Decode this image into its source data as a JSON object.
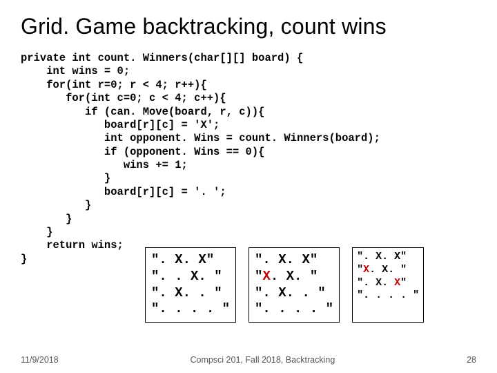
{
  "title": "Grid. Game backtracking, count wins",
  "code_lines": [
    "private int count. Winners(char[][] board) {",
    "    int wins = 0;",
    "    for(int r=0; r < 4; r++){",
    "       for(int c=0; c < 4; c++){",
    "          if (can. Move(board, r, c)){",
    "             board[r][c] = 'X';",
    "             int opponent. Wins = count. Winners(board);",
    "             if (opponent. Wins == 0){",
    "                wins += 1;",
    "             }",
    "             board[r][c] = '. ';",
    "          }",
    "       }",
    "    }",
    "    return wins;",
    "}"
  ],
  "boards": [
    {
      "size": "big",
      "rows": [
        [
          {
            "t": "\". X. X\""
          }
        ],
        [
          {
            "t": "\". . X. \""
          }
        ],
        [
          {
            "t": "\". X. . \""
          }
        ],
        [
          {
            "t": "\". . . . \""
          }
        ]
      ]
    },
    {
      "size": "big",
      "rows": [
        [
          {
            "t": "\". X. X\""
          }
        ],
        [
          {
            "t": "\""
          },
          {
            "t": "X",
            "red": true
          },
          {
            "t": ". X. \""
          }
        ],
        [
          {
            "t": "\". X. . \""
          }
        ],
        [
          {
            "t": "\". . . . \""
          }
        ]
      ]
    },
    {
      "size": "small",
      "rows": [
        [
          {
            "t": "\". X. X\""
          }
        ],
        [
          {
            "t": "\""
          },
          {
            "t": "X",
            "red": true
          },
          {
            "t": ". X. \""
          }
        ],
        [
          {
            "t": "\". X. "
          },
          {
            "t": "X",
            "red": true
          },
          {
            "t": "\""
          }
        ],
        [
          {
            "t": "\". . . . \""
          }
        ]
      ]
    }
  ],
  "footer": {
    "left": "11/9/2018",
    "center": "Compsci 201, Fall 2018, Backtracking",
    "right": "28"
  }
}
